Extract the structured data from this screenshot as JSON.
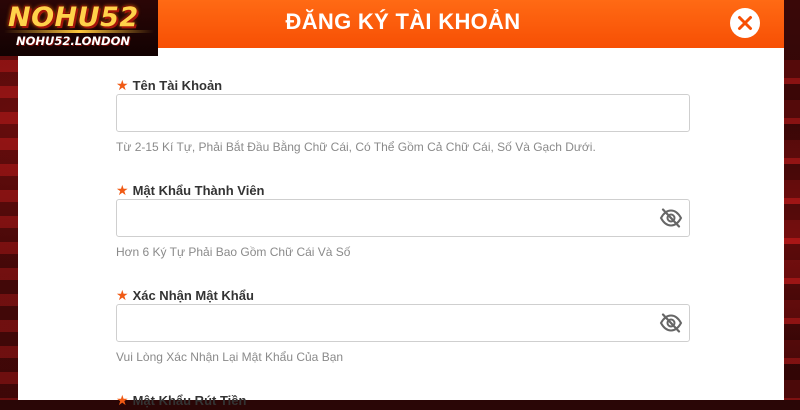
{
  "logo": {
    "main": "NOHU52",
    "sub": "NOHU52.LONDON"
  },
  "modal": {
    "title": "ĐĂNG KÝ TÀI KHOẢN"
  },
  "fields": [
    {
      "label": "Tên Tài Khoản",
      "value": "",
      "placeholder": "",
      "hint": "Từ 2-15 Kí Tự, Phải Bắt Đầu Bằng Chữ Cái, Có Thể Gồm Cả Chữ Cái, Số Và Gạch Dưới."
    },
    {
      "label": "Mật Khẩu Thành Viên",
      "value": "",
      "placeholder": "",
      "hint": "Hơn 6 Ký Tự Phải Bao Gồm Chữ Cái Và Số"
    },
    {
      "label": "Xác Nhận Mật Khẩu",
      "value": "",
      "placeholder": "",
      "hint": "Vui Lòng Xác Nhận Lại Mật Khẩu Của Bạn"
    },
    {
      "label": "Mật Khẩu Rút Tiền"
    }
  ],
  "required_marker": "★",
  "icons": {
    "close": "close-icon",
    "eye": "eye-off-icon",
    "star": "required-star-icon"
  },
  "colors": {
    "accent": "#f74f04",
    "star": "#f05a14",
    "hint": "#8a8a8a",
    "label": "#333333"
  }
}
